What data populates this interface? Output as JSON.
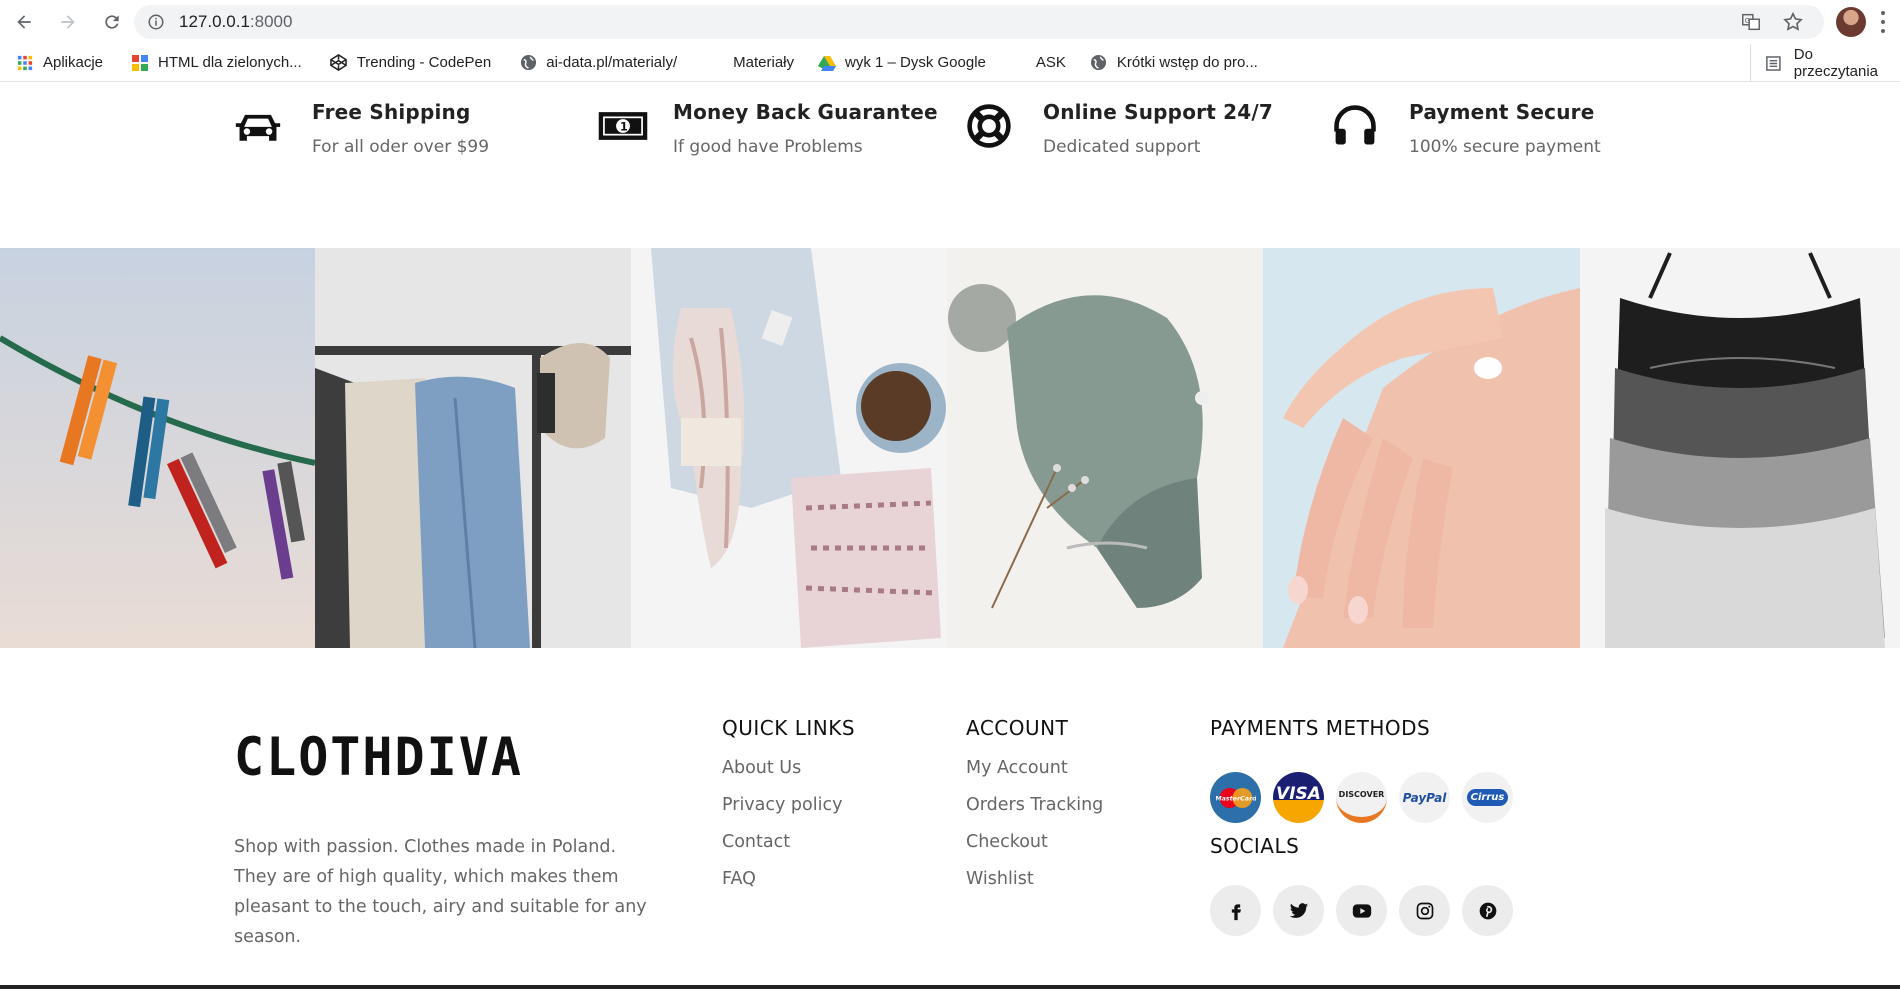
{
  "browser": {
    "url_host": "127.0.0.1",
    "url_port": ":8000",
    "bookmarks": [
      "Aplikacje",
      "HTML dla zielonych...",
      "Trending - CodePen",
      "ai-data.pl/materialy/",
      "Materiały",
      "wyk 1 – Dysk Google",
      "ASK",
      "Krótki wstęp do pro..."
    ],
    "reading_list": "Do przeczytania"
  },
  "features": [
    {
      "icon": "car-icon",
      "title": "Free Shipping",
      "subtitle": "For all oder over $99"
    },
    {
      "icon": "money-icon",
      "title": "Money Back Guarantee",
      "subtitle": "If good have Problems"
    },
    {
      "icon": "lifebuoy-icon",
      "title": "Online Support 24/7",
      "subtitle": "Dedicated support"
    },
    {
      "icon": "headphones-icon",
      "title": "Payment Secure",
      "subtitle": "100% secure payment"
    }
  ],
  "gallery": [
    "clothespins-photo",
    "clothes-rack-photo",
    "yarn-jeans-photo",
    "knitted-hat-photo",
    "hand-cream-photo",
    "tank-tops-photo"
  ],
  "footer": {
    "logo": "CLOTHDIVA",
    "about": "Shop with passion. Clothes made in Poland. They are of high quality, which makes them pleasant to the touch, airy and suitable for any season.",
    "quick_links": {
      "title": "QUICK LINKS",
      "items": [
        "About Us",
        "Privacy policy",
        "Contact",
        "FAQ"
      ]
    },
    "account": {
      "title": "ACCOUNT",
      "items": [
        "My Account",
        "Orders Tracking",
        "Checkout",
        "Wishlist"
      ]
    },
    "payments": {
      "title": "PAYMENTS METHODS",
      "items": [
        "MasterCard",
        "VISA",
        "DISCOVER",
        "PayPal",
        "Cirrus"
      ]
    },
    "socials": {
      "title": "SOCIALS",
      "items": [
        "facebook-icon",
        "twitter-icon",
        "youtube-icon",
        "instagram-icon",
        "pinterest-icon"
      ]
    }
  }
}
